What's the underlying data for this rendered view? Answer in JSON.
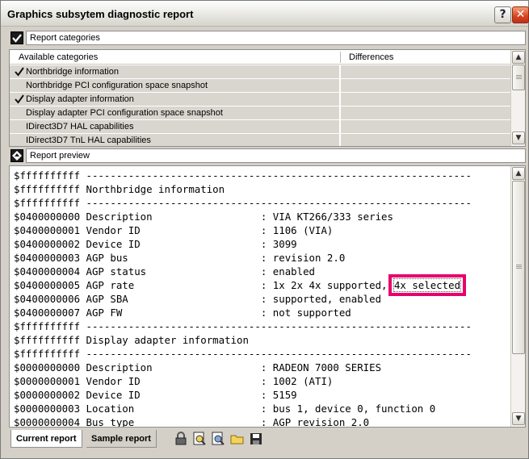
{
  "window": {
    "title": "Graphics subsytem diagnostic report",
    "help_label": "?",
    "close_label": "✕"
  },
  "categories_section": {
    "label": "Report categories",
    "icon": "checkmark-icon"
  },
  "categories_table": {
    "columns": [
      "Available categories",
      "Differences"
    ],
    "rows": [
      {
        "label": "Northbridge information",
        "checked": true
      },
      {
        "label": "Northbridge PCI configuration space snapshot",
        "checked": false
      },
      {
        "label": "Display adapter information",
        "checked": true
      },
      {
        "label": "Display adapter PCI configuration space snapshot",
        "checked": false
      },
      {
        "label": "IDirect3D7 HAL capabilities",
        "checked": false
      },
      {
        "label": "IDirect3D7 TnL HAL capabilities",
        "checked": false
      }
    ]
  },
  "preview_section": {
    "label": "Report preview",
    "icon": "diamond-arrows-icon"
  },
  "preview_lines": [
    "$ffffffffff ----------------------------------------------------------------",
    "$ffffffffff Northbridge information",
    "$ffffffffff ----------------------------------------------------------------",
    "$0400000000 Description                  : VIA KT266/333 series",
    "$0400000001 Vendor ID                    : 1106 (VIA)",
    "$0400000002 Device ID                    : 3099",
    "$0400000003 AGP bus                      : revision 2.0",
    "$0400000004 AGP status                   : enabled",
    "$0400000005 AGP rate                     : 1x 2x 4x supported, ",
    "$0400000006 AGP SBA                      : supported, enabled",
    "$0400000007 AGP FW                       : not supported",
    "$ffffffffff ----------------------------------------------------------------",
    "$ffffffffff Display adapter information",
    "$ffffffffff ----------------------------------------------------------------",
    "$0000000000 Description                  : RADEON 7000 SERIES",
    "$0000000001 Vendor ID                    : 1002 (ATI)",
    "$0000000002 Device ID                    : 5159",
    "$0000000003 Location                     : bus 1, device 0, function 0",
    "$0000000004 Bus type                     : AGP revision 2.0"
  ],
  "highlighted_value": "4x selected",
  "tabs": {
    "current": "Current report",
    "sample": "Sample report"
  },
  "toolbar_icons": [
    "lock-icon",
    "report-find-icon",
    "report-compare-icon",
    "open-folder-icon",
    "save-disk-icon"
  ]
}
